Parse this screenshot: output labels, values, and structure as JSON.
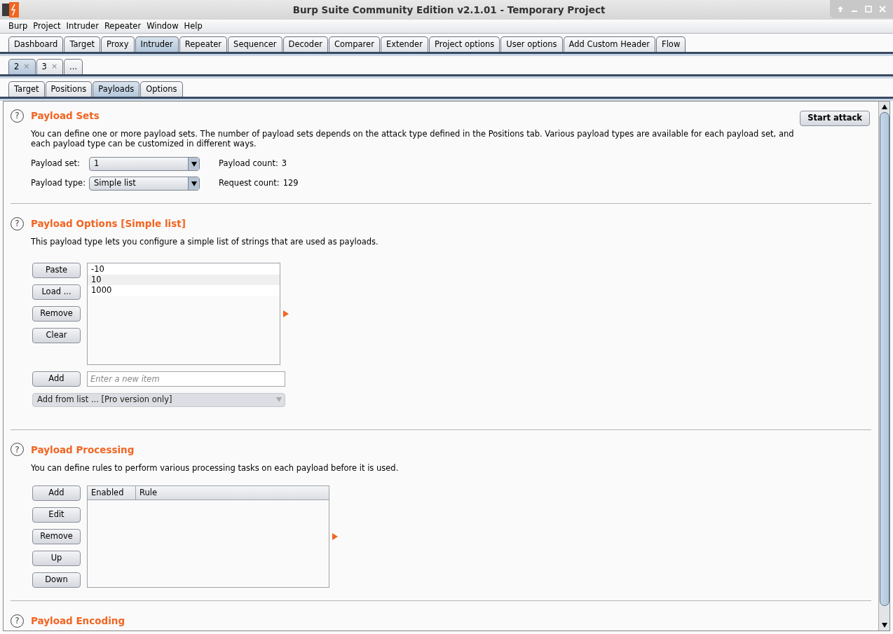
{
  "window": {
    "title": "Burp Suite Community Edition v2.1.01 - Temporary Project"
  },
  "menu": [
    "Burp",
    "Project",
    "Intruder",
    "Repeater",
    "Window",
    "Help"
  ],
  "main_tabs": [
    {
      "label": "Dashboard",
      "selected": false
    },
    {
      "label": "Target",
      "selected": false
    },
    {
      "label": "Proxy",
      "selected": false
    },
    {
      "label": "Intruder",
      "selected": true
    },
    {
      "label": "Repeater",
      "selected": false
    },
    {
      "label": "Sequencer",
      "selected": false
    },
    {
      "label": "Decoder",
      "selected": false
    },
    {
      "label": "Comparer",
      "selected": false
    },
    {
      "label": "Extender",
      "selected": false
    },
    {
      "label": "Project options",
      "selected": false
    },
    {
      "label": "User options",
      "selected": false
    },
    {
      "label": "Add Custom Header",
      "selected": false
    },
    {
      "label": "Flow",
      "selected": false
    }
  ],
  "attack_tabs": [
    {
      "label": "2",
      "close": "×",
      "selected": true
    },
    {
      "label": "3",
      "close": "×",
      "selected": false
    },
    {
      "label": "...",
      "selected": false
    }
  ],
  "sub_tabs": [
    {
      "label": "Target",
      "selected": false
    },
    {
      "label": "Positions",
      "selected": false
    },
    {
      "label": "Payloads",
      "selected": true
    },
    {
      "label": "Options",
      "selected": false
    }
  ],
  "payload_sets": {
    "help": "?",
    "title": "Payload Sets",
    "start_button": "Start attack",
    "description": "You can define one or more payload sets. The number of payload sets depends on the attack type defined in the Positions tab. Various payload types are available for each payload set, and each payload type can be customized in different ways.",
    "fields": [
      {
        "label": "Payload set:",
        "value": "1",
        "count_label": "Payload count:",
        "count": "3"
      },
      {
        "label": "Payload type:",
        "value": "Simple list",
        "count_label": "Request count:",
        "count": "129"
      }
    ]
  },
  "payload_options": {
    "help": "?",
    "title": "Payload Options [Simple list]",
    "description": "This payload type lets you configure a simple list of strings that are used as payloads.",
    "buttons": [
      "Paste",
      "Load ...",
      "Remove",
      "Clear"
    ],
    "items": [
      "-10",
      "10",
      "1000"
    ],
    "add_button": "Add",
    "new_item_placeholder": "Enter a new item",
    "add_from_list": {
      "value": "Add from list ... [Pro version only]",
      "disabled": true
    }
  },
  "payload_processing": {
    "help": "?",
    "title": "Payload Processing",
    "description": "You can define rules to perform various processing tasks on each payload before it is used.",
    "buttons": [
      "Add",
      "Edit",
      "Remove",
      "Up",
      "Down"
    ],
    "columns": [
      "Enabled",
      "Rule"
    ]
  },
  "payload_encoding": {
    "help": "?",
    "title": "Payload Encoding"
  }
}
